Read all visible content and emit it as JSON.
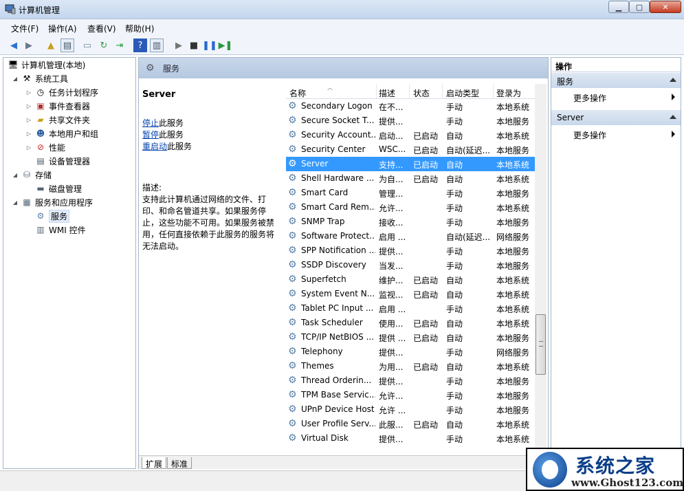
{
  "window": {
    "title": "计算机管理"
  },
  "menu": [
    "文件(F)",
    "操作(A)",
    "查看(V)",
    "帮助(H)"
  ],
  "tree": [
    {
      "label": "计算机管理(本地)",
      "level": 0,
      "expander": "",
      "icon": "computer-icon"
    },
    {
      "label": "系统工具",
      "level": 1,
      "expander": "◢",
      "icon": "tools-icon"
    },
    {
      "label": "任务计划程序",
      "level": 2,
      "expander": "▷",
      "icon": "clock-icon"
    },
    {
      "label": "事件查看器",
      "level": 2,
      "expander": "▷",
      "icon": "event-viewer-icon"
    },
    {
      "label": "共享文件夹",
      "level": 2,
      "expander": "▷",
      "icon": "shared-folder-icon"
    },
    {
      "label": "本地用户和组",
      "level": 2,
      "expander": "▷",
      "icon": "users-icon"
    },
    {
      "label": "性能",
      "level": 2,
      "expander": "▷",
      "icon": "performance-icon"
    },
    {
      "label": "设备管理器",
      "level": 2,
      "expander": "",
      "icon": "device-manager-icon"
    },
    {
      "label": "存储",
      "level": 1,
      "expander": "◢",
      "icon": "storage-icon"
    },
    {
      "label": "磁盘管理",
      "level": 2,
      "expander": "",
      "icon": "disk-icon"
    },
    {
      "label": "服务和应用程序",
      "level": 1,
      "expander": "◢",
      "icon": "services-apps-icon"
    },
    {
      "label": "服务",
      "level": 2,
      "expander": "",
      "icon": "services-icon",
      "selected": true
    },
    {
      "label": "WMI 控件",
      "level": 2,
      "expander": "",
      "icon": "wmi-icon"
    }
  ],
  "center": {
    "header": "服务",
    "service_title": "Server",
    "stop_link": "停止",
    "stop_rest": "此服务",
    "pause_link": "暂停",
    "pause_rest": "此服务",
    "restart_link": "重启动",
    "restart_rest": "此服务",
    "desc_label": "描述:",
    "desc_lines": [
      "支持此计算机通过网络的文件、打",
      "印、和命名管道共享。如果服务停",
      "止，这些功能不可用。如果服务被禁",
      "用，任何直接依赖于此服务的服务将",
      "无法启动。"
    ]
  },
  "columns": [
    "名称",
    "描述",
    "状态",
    "启动类型",
    "登录为"
  ],
  "services": [
    {
      "name": "Secondary Logon",
      "desc": "在不...",
      "status": "",
      "start": "手动",
      "logon": "本地系统"
    },
    {
      "name": "Secure Socket T...",
      "desc": "提供...",
      "status": "",
      "start": "手动",
      "logon": "本地服务"
    },
    {
      "name": "Security Account...",
      "desc": "启动...",
      "status": "已启动",
      "start": "自动",
      "logon": "本地系统"
    },
    {
      "name": "Security Center",
      "desc": "WSC...",
      "status": "已启动",
      "start": "自动(延迟...",
      "logon": "本地服务"
    },
    {
      "name": "Server",
      "desc": "支持...",
      "status": "已启动",
      "start": "自动",
      "logon": "本地系统",
      "selected": true
    },
    {
      "name": "Shell Hardware ...",
      "desc": "为自...",
      "status": "已启动",
      "start": "自动",
      "logon": "本地系统"
    },
    {
      "name": "Smart Card",
      "desc": "管理...",
      "status": "",
      "start": "手动",
      "logon": "本地服务"
    },
    {
      "name": "Smart Card Rem...",
      "desc": "允许...",
      "status": "",
      "start": "手动",
      "logon": "本地系统"
    },
    {
      "name": "SNMP Trap",
      "desc": "接收...",
      "status": "",
      "start": "手动",
      "logon": "本地服务"
    },
    {
      "name": "Software Protect...",
      "desc": "启用 ...",
      "status": "",
      "start": "自动(延迟...",
      "logon": "网络服务"
    },
    {
      "name": "SPP Notification ...",
      "desc": "提供...",
      "status": "",
      "start": "手动",
      "logon": "本地服务"
    },
    {
      "name": "SSDP Discovery",
      "desc": "当发...",
      "status": "",
      "start": "手动",
      "logon": "本地服务"
    },
    {
      "name": "Superfetch",
      "desc": "维护...",
      "status": "已启动",
      "start": "自动",
      "logon": "本地系统"
    },
    {
      "name": "System Event N...",
      "desc": "监视...",
      "status": "已启动",
      "start": "自动",
      "logon": "本地系统"
    },
    {
      "name": "Tablet PC Input ...",
      "desc": "启用 ...",
      "status": "",
      "start": "手动",
      "logon": "本地系统"
    },
    {
      "name": "Task Scheduler",
      "desc": "使用...",
      "status": "已启动",
      "start": "自动",
      "logon": "本地系统"
    },
    {
      "name": "TCP/IP NetBIOS ...",
      "desc": "提供 ...",
      "status": "已启动",
      "start": "自动",
      "logon": "本地服务"
    },
    {
      "name": "Telephony",
      "desc": "提供...",
      "status": "",
      "start": "手动",
      "logon": "网络服务"
    },
    {
      "name": "Themes",
      "desc": "为用...",
      "status": "已启动",
      "start": "自动",
      "logon": "本地系统"
    },
    {
      "name": "Thread Orderin...",
      "desc": "提供...",
      "status": "",
      "start": "手动",
      "logon": "本地服务"
    },
    {
      "name": "TPM Base Servic...",
      "desc": "允许...",
      "status": "",
      "start": "手动",
      "logon": "本地服务"
    },
    {
      "name": "UPnP Device Host",
      "desc": "允许 ...",
      "status": "",
      "start": "手动",
      "logon": "本地服务"
    },
    {
      "name": "User Profile Serv...",
      "desc": "此服...",
      "status": "已启动",
      "start": "自动",
      "logon": "本地系统"
    },
    {
      "name": "Virtual Disk",
      "desc": "提供...",
      "status": "",
      "start": "手动",
      "logon": "本地系统"
    }
  ],
  "tabs": [
    "扩展",
    "标准"
  ],
  "actions": {
    "header": "操作",
    "sections": [
      {
        "title": "服务",
        "item": "更多操作"
      },
      {
        "title": "Server",
        "item": "更多操作"
      }
    ]
  },
  "watermark": {
    "text": "系统之家",
    "url": "www.Ghost123.com"
  },
  "colors": {
    "selection": "#3399ff",
    "link": "#0645ad"
  }
}
